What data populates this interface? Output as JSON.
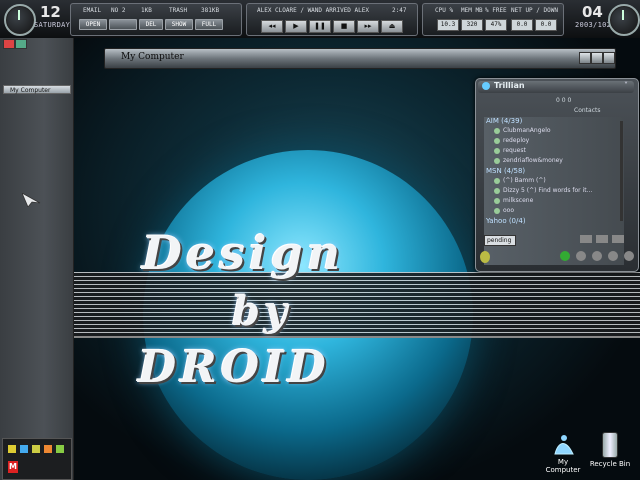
{
  "topbar": {
    "day": "12",
    "weekday": "SATURDAY",
    "email_label": "EMAIL",
    "email_value": "NO 2",
    "trash_label": "TRASH",
    "trash_size1": "1KB",
    "trash_size2": "381KB",
    "btn_open": "OPEN",
    "btn_del": "DEL",
    "btn_show": "SHOW",
    "btn_full": "FULL",
    "track": "ALEX CLOARE / WAND ARRIVED ALEX",
    "track_time": "2:47",
    "cpu_label": "CPU %",
    "mem_label": "MEM MB",
    "mem_pct_label": "% FREE",
    "net_label": "NET UP / DOWN",
    "cpu_value": "10.3",
    "mem_value": "320",
    "free_value": "47%",
    "net_up": "0.0",
    "net_down": "0.0",
    "month_num": "04",
    "date": "2003/102"
  },
  "sidebar": {
    "item_label": "My Computer"
  },
  "window": {
    "title": "My Computer"
  },
  "logo": {
    "line1": "Design",
    "line2": "by",
    "line3": "DROID"
  },
  "trillian": {
    "title": "Trillian",
    "contacts_label": "Contacts",
    "counter": "0 0 0",
    "groups": [
      {
        "name": "AIM (4/39)",
        "contacts": [
          "ClubmanAngelo",
          "redeploy",
          "request",
          "zendriaflow&money"
        ]
      },
      {
        "name": "MSN (4/58)",
        "contacts": [
          "(^) Bamm (^)",
          "Dizzy 5 (^) Find words for it...",
          "milkscene",
          "ooo"
        ]
      },
      {
        "name": "Yahoo (0/4)",
        "contacts": []
      }
    ],
    "status": "pending"
  },
  "desktop": {
    "icons": [
      {
        "label": "My Computer"
      },
      {
        "label": "Recycle Bin"
      }
    ]
  },
  "colors": {
    "accent": "#2fb5dd",
    "panel": "#3b4046"
  }
}
